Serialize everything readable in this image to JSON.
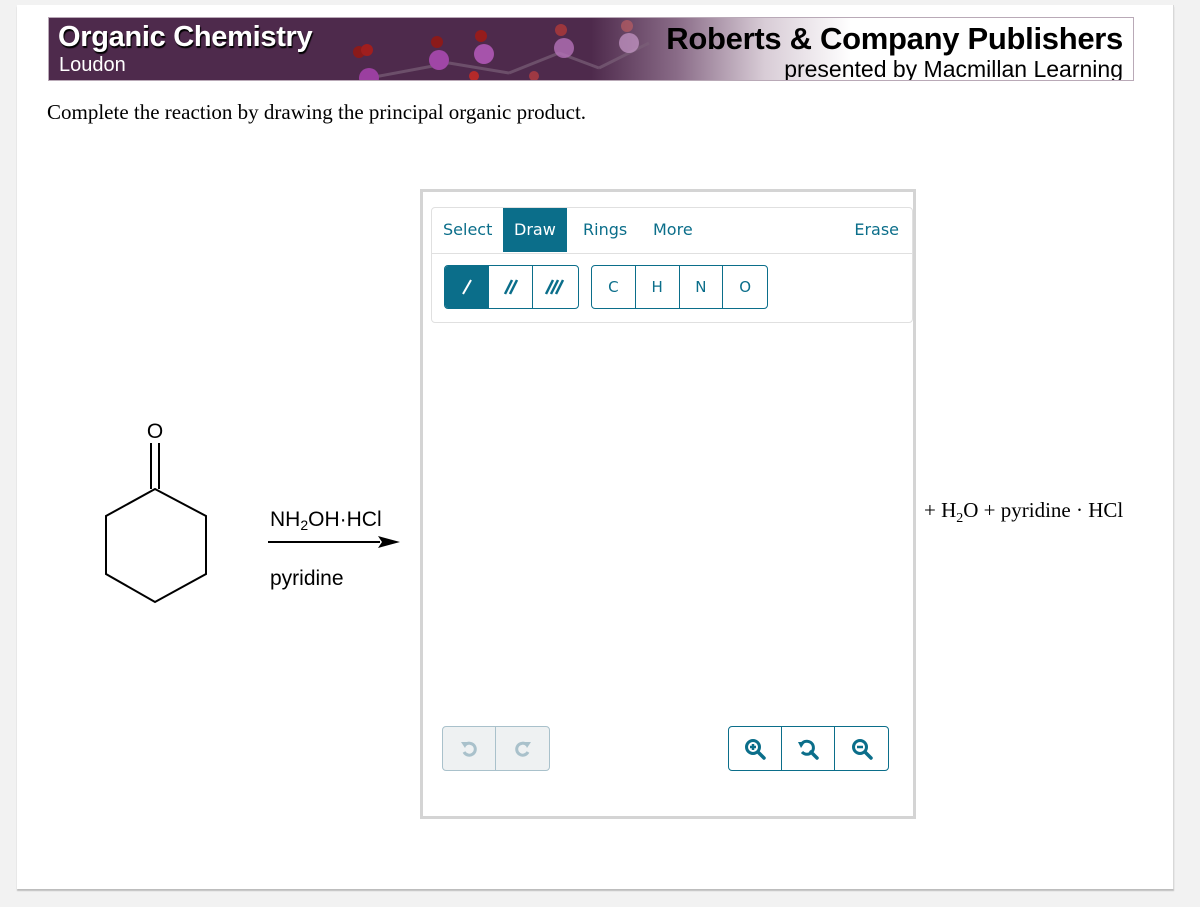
{
  "banner": {
    "title": "Organic Chemistry",
    "subtitle": "Loudon",
    "publisher": "Roberts & Company Publishers",
    "publisher_sub": "presented by Macmillan Learning"
  },
  "question": {
    "prompt": "Complete the reaction by drawing the principal organic product."
  },
  "reaction": {
    "reactant": "cyclohexanone",
    "reactant_atom_label": "O",
    "reagent_above": {
      "main": "NH",
      "sub": "2",
      "rest": "OH·HCl"
    },
    "reagent_below": "pyridine",
    "byproducts": {
      "pre": "+ H",
      "sub": "2",
      "post": "O + pyridine · HCl"
    }
  },
  "editor": {
    "tabs": [
      {
        "label": "Select",
        "active": false
      },
      {
        "label": "Draw",
        "active": true
      },
      {
        "label": "Rings",
        "active": false
      },
      {
        "label": "More",
        "active": false
      }
    ],
    "erase_label": "Erase",
    "bond_buttons": [
      {
        "name": "single-bond",
        "active": true
      },
      {
        "name": "double-bond",
        "active": false
      },
      {
        "name": "triple-bond",
        "active": false
      }
    ],
    "atom_buttons": [
      "C",
      "H",
      "N",
      "O"
    ],
    "undo_icon": "undo-icon",
    "redo_icon": "redo-icon",
    "zoom_buttons": [
      "zoom-in-icon",
      "zoom-reset-icon",
      "zoom-out-icon"
    ]
  },
  "colors": {
    "accent": "#0b6e8a",
    "banner": "#4e2a4c",
    "disabled": "#a9c1cb"
  }
}
